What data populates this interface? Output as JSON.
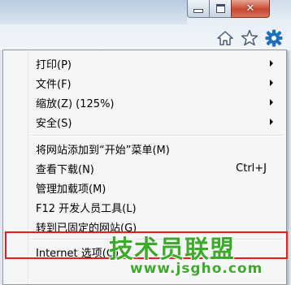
{
  "window": {
    "minimize_icon": "minimize-icon",
    "maximize_icon": "maximize-icon",
    "close_glyph": "✕"
  },
  "toolbar": {
    "icons": [
      "home-icon",
      "favorites-star-icon",
      "tools-gear-icon"
    ],
    "accent": "#1e6fc2"
  },
  "menu": {
    "items": [
      {
        "label": "打印(P)",
        "submenu": true
      },
      {
        "label": "文件(F)",
        "submenu": true
      },
      {
        "label": "缩放(Z) (125%)",
        "submenu": true
      },
      {
        "label": "安全(S)",
        "submenu": true
      },
      {
        "label": "将网站添加到“开始”菜单(M)",
        "submenu": false
      },
      {
        "label": "查看下载(N)",
        "shortcut": "Ctrl+J"
      },
      {
        "label": "管理加载项(M)"
      },
      {
        "label": "F12 开发人员工具(L)"
      },
      {
        "label": "转到已固定的网站(G)"
      },
      {
        "label": "Internet 选项(O)"
      }
    ]
  },
  "watermark": {
    "text": "技术员联盟",
    "url": "www.jsgho.com",
    "color": "#3dab2a"
  },
  "highlight_color": "#e21e1e"
}
